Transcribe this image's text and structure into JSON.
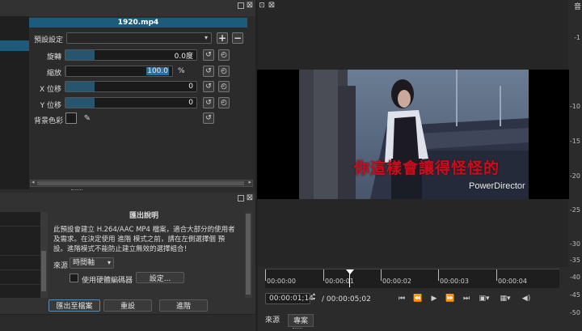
{
  "filters": {
    "header_title": "1920.mp4",
    "preset_label": "預設設定",
    "rows": [
      {
        "label": "旋轉",
        "value": "0.0度",
        "fill": 0.22
      },
      {
        "label": "縮放",
        "value": "100.0",
        "unit": "%",
        "fill": 0.01
      },
      {
        "label": "X 位移",
        "value": "0",
        "fill": 0.22
      },
      {
        "label": "Y 位移",
        "value": "0",
        "fill": 0.22
      }
    ],
    "bg_color_label": "背景色彩"
  },
  "export": {
    "title": "匯出說明",
    "description": "此預設會建立 H.264/AAC MP4 檔案，適合大部分的使用者及需求。在決定使用 進階 模式之前，請在左側選擇個 預設。進階模式不能防止建立無效的選擇組合！",
    "source_label": "來源",
    "source_value": "時間軸",
    "hw_encoder_label": "使用硬體編碼器",
    "settings_button": "設定...",
    "export_file_button": "匯出至檔案",
    "reset_button": "重設",
    "advanced_button": "進階"
  },
  "player": {
    "lyric_text": "你這樣會讓得怪怪的",
    "watermark": "PowerDirector",
    "ruler_labels": [
      "00:00:00",
      "00:00:01",
      "00:00:02",
      "00:00:03",
      "00:00:04"
    ],
    "current_time": "00:00:01;14",
    "total_time": "/ 00:00:05;02",
    "tab_source": "來源",
    "tab_project": "專案",
    "scale_labels": [
      "-1",
      "-10",
      "-15",
      "-20",
      "-25",
      "-30",
      "-35",
      "-40",
      "-45",
      "-50"
    ],
    "top_right_char": "音"
  },
  "colors": {
    "accent": "#1d5b7c",
    "slider_fill": "#26556f",
    "lyric": "#c4101e"
  }
}
